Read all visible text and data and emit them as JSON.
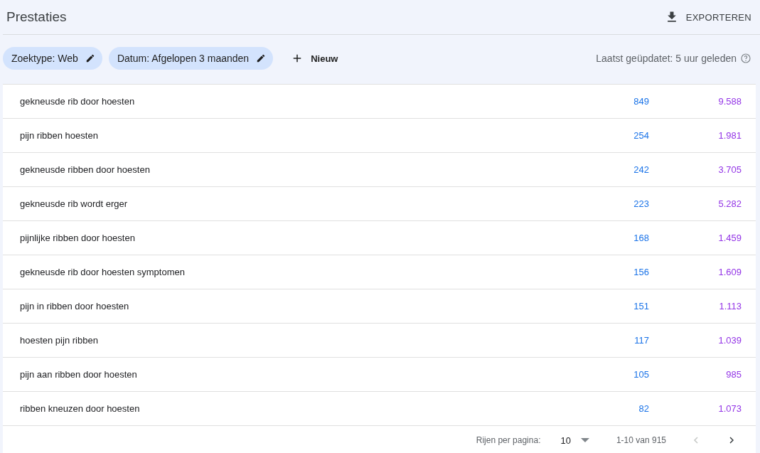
{
  "header": {
    "title": "Prestaties",
    "export_label": "EXPORTEREN"
  },
  "filters": {
    "chips": [
      {
        "label": "Zoektype: Web"
      },
      {
        "label": "Datum: Afgelopen 3 maanden"
      }
    ],
    "new_label": "Nieuw",
    "updated": "Laatst geüpdatet: 5 uur geleden"
  },
  "table": {
    "rows": [
      {
        "query": "gekneusde rib door hoesten",
        "column_2": "849",
        "column_3": "9.588"
      },
      {
        "query": "pijn ribben hoesten",
        "column_2": "254",
        "column_3": "1.981"
      },
      {
        "query": "gekneusde ribben door hoesten",
        "column_2": "242",
        "column_3": "3.705"
      },
      {
        "query": "gekneusde rib wordt erger",
        "column_2": "223",
        "column_3": "5.282"
      },
      {
        "query": "pijnlijke ribben door hoesten",
        "column_2": "168",
        "column_3": "1.459"
      },
      {
        "query": "gekneusde rib door hoesten symptomen",
        "column_2": "156",
        "column_3": "1.609"
      },
      {
        "query": "pijn in ribben door hoesten",
        "column_2": "151",
        "column_3": "1.113"
      },
      {
        "query": "hoesten pijn ribben",
        "column_2": "117",
        "column_3": "1.039"
      },
      {
        "query": "pijn aan ribben door hoesten",
        "column_2": "105",
        "column_3": "985"
      },
      {
        "query": "ribben kneuzen door hoesten",
        "column_2": "82",
        "column_3": "1.073"
      }
    ]
  },
  "pagination": {
    "rows_per_page_label": "Rijen per pagina:",
    "rows_per_page": "10",
    "range": "1-10 van 915",
    "previous": {
      "disabled": true
    },
    "next": {
      "disabled": false
    }
  }
}
